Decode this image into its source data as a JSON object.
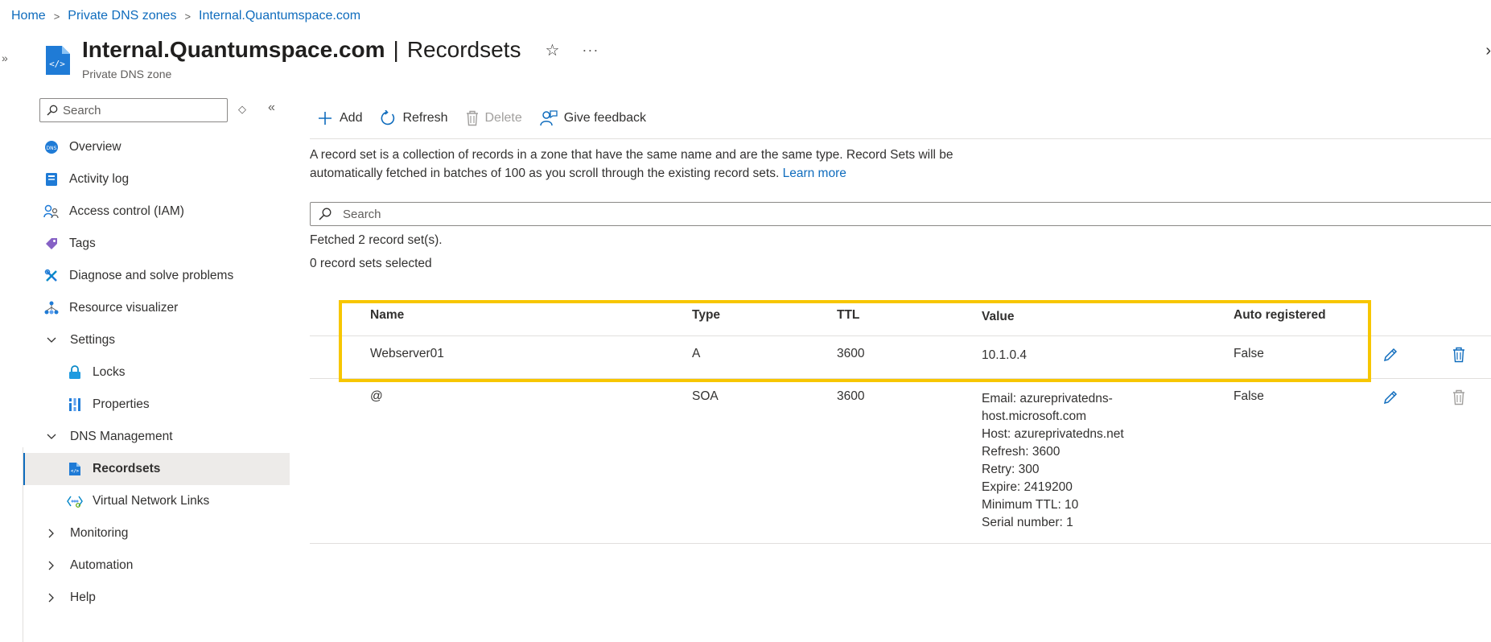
{
  "breadcrumb": {
    "items": [
      "Home",
      "Private DNS zones",
      "Internal.Quantumspace.com"
    ],
    "separator": ">"
  },
  "header": {
    "resource_name": "Internal.Quantumspace.com",
    "divider": "|",
    "blade": "Recordsets",
    "subtitle": "Private DNS zone",
    "star": "☆",
    "more": "···"
  },
  "chrome": {
    "expand": "»",
    "close": "›",
    "sort": "◇",
    "collapse": "«"
  },
  "sidebar": {
    "search_placeholder": "Search",
    "items": [
      {
        "label": "Overview",
        "icon": "overview-icon"
      },
      {
        "label": "Activity log",
        "icon": "activity-log-icon"
      },
      {
        "label": "Access control (IAM)",
        "icon": "iam-icon"
      },
      {
        "label": "Tags",
        "icon": "tag-icon"
      },
      {
        "label": "Diagnose and solve problems",
        "icon": "wrench-icon"
      },
      {
        "label": "Resource visualizer",
        "icon": "visualizer-icon"
      },
      {
        "label": "Settings",
        "group": true,
        "expanded": true
      },
      {
        "label": "Locks",
        "icon": "lock-icon",
        "sub": true
      },
      {
        "label": "Properties",
        "icon": "properties-icon",
        "sub": true
      },
      {
        "label": "DNS Management",
        "group": true,
        "expanded": true
      },
      {
        "label": "Recordsets",
        "icon": "recordsets-icon",
        "sub": true,
        "active": true
      },
      {
        "label": "Virtual Network Links",
        "icon": "network-links-icon",
        "sub": true
      },
      {
        "label": "Monitoring",
        "group": true,
        "expanded": false
      },
      {
        "label": "Automation",
        "group": true,
        "expanded": false
      },
      {
        "label": "Help",
        "group": true,
        "expanded": false
      }
    ]
  },
  "toolbar": {
    "add": "Add",
    "refresh": "Refresh",
    "delete": "Delete",
    "feedback": "Give feedback"
  },
  "description": {
    "text": "A record set is a collection of records in a zone that have the same name and are the same type. Record Sets will be automatically fetched in batches of 100 as you scroll through the existing record sets.",
    "link": "Learn more"
  },
  "search": {
    "placeholder": "Search"
  },
  "status": {
    "fetched": "Fetched 2 record set(s).",
    "selected": "0 record sets selected"
  },
  "table": {
    "columns": [
      "Name",
      "Type",
      "TTL",
      "Value",
      "Auto registered"
    ],
    "rows": [
      {
        "name": "Webserver01",
        "type": "A",
        "ttl": "3600",
        "value": [
          "10.1.0.4"
        ],
        "auto": "False",
        "delete_enabled": true
      },
      {
        "name": "@",
        "type": "SOA",
        "ttl": "3600",
        "value": [
          "Email: azureprivatedns-",
          "host.microsoft.com",
          "Host: azureprivatedns.net",
          "Refresh: 3600",
          "Retry: 300",
          "Expire: 2419200",
          "Minimum TTL: 10",
          "Serial number: 1"
        ],
        "auto": "False",
        "delete_enabled": false
      }
    ]
  },
  "colors": {
    "accent": "#0f6cbd",
    "highlight": "#f7c600",
    "active_bg": "#edebe9"
  }
}
